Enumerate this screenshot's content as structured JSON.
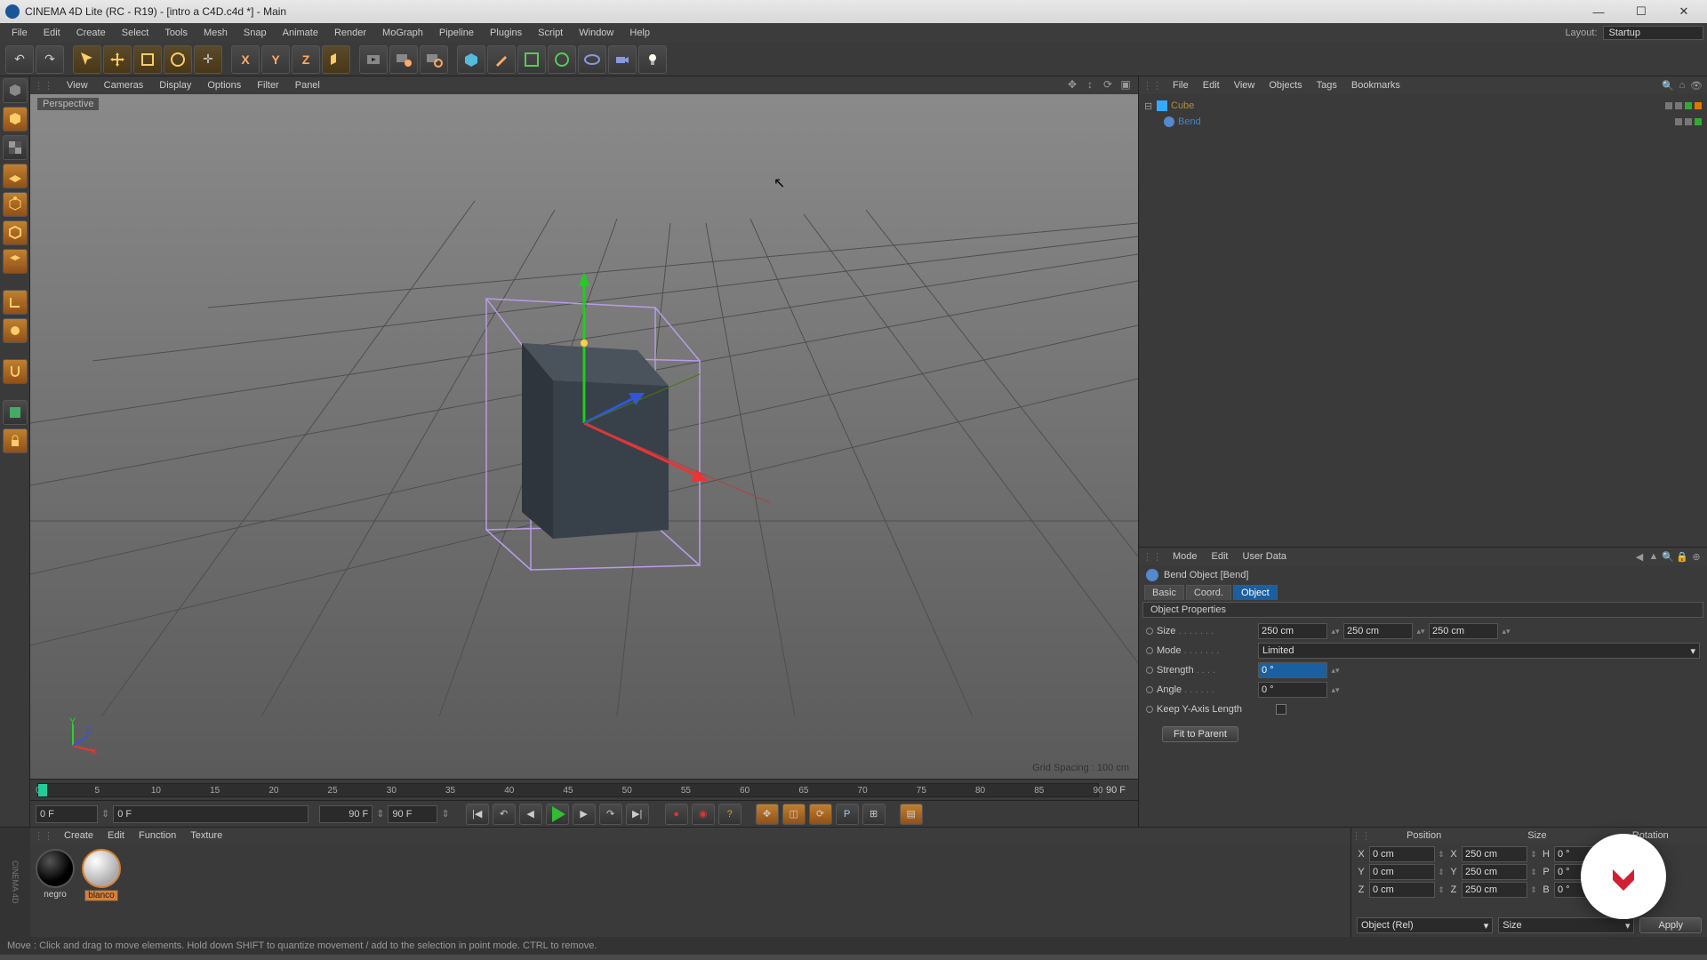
{
  "title": "CINEMA 4D Lite (RC - R19) - [intro a C4D.c4d *] - Main",
  "menus": [
    "File",
    "Edit",
    "Create",
    "Select",
    "Tools",
    "Mesh",
    "Snap",
    "Animate",
    "Render",
    "MoGraph",
    "Pipeline",
    "Plugins",
    "Script",
    "Window",
    "Help"
  ],
  "layout_label": "Layout:",
  "layout_value": "Startup",
  "viewport_menus": [
    "View",
    "Cameras",
    "Display",
    "Options",
    "Filter",
    "Panel"
  ],
  "viewport_label": "Perspective",
  "grid_spacing": "Grid Spacing : 100 cm",
  "timeline": {
    "ticks": [
      0,
      5,
      10,
      15,
      20,
      25,
      30,
      35,
      40,
      45,
      50,
      55,
      60,
      65,
      70,
      75,
      80,
      85,
      90
    ],
    "end": "90 F"
  },
  "play": {
    "cur": "0 F",
    "rng_start": "0 F",
    "rng_end": "90 F",
    "frame": "90 F"
  },
  "objects_menus": [
    "File",
    "Edit",
    "View",
    "Objects",
    "Tags",
    "Bookmarks"
  ],
  "tree": {
    "cube": "Cube",
    "bend": "Bend"
  },
  "attr_menus": [
    "Mode",
    "Edit",
    "User Data"
  ],
  "attr_title": "Bend Object [Bend]",
  "tabs": {
    "basic": "Basic",
    "coord": "Coord.",
    "object": "Object"
  },
  "section": "Object Properties",
  "props": {
    "size_label": "Size",
    "size_x": "250 cm",
    "size_y": "250 cm",
    "size_z": "250 cm",
    "mode_label": "Mode",
    "mode_value": "Limited",
    "strength_label": "Strength",
    "strength_value": "0 °",
    "angle_label": "Angle",
    "angle_value": "0 °",
    "keep_label": "Keep Y-Axis Length",
    "fit": "Fit to Parent"
  },
  "mat_menus": [
    "Create",
    "Edit",
    "Function",
    "Texture"
  ],
  "materials": {
    "negro": "negro",
    "blanco": "blanco"
  },
  "coord_head": {
    "pos": "Position",
    "size": "Size",
    "rot": "Rotation"
  },
  "coord": {
    "px": "0 cm",
    "py": "0 cm",
    "pz": "0 cm",
    "sx": "250 cm",
    "sy": "250 cm",
    "sz": "250 cm",
    "rh": "0 °",
    "rp": "0 °",
    "rb": "0 °"
  },
  "coord_axes": {
    "x": "X",
    "y": "Y",
    "z": "Z",
    "h": "H",
    "p": "P",
    "b": "B"
  },
  "coord_foot": {
    "mode": "Object (Rel)",
    "scale": "Size",
    "apply": "Apply"
  },
  "status": "Move : Click and drag to move elements. Hold down SHIFT to quantize movement / add to the selection in point mode. CTRL to remove."
}
